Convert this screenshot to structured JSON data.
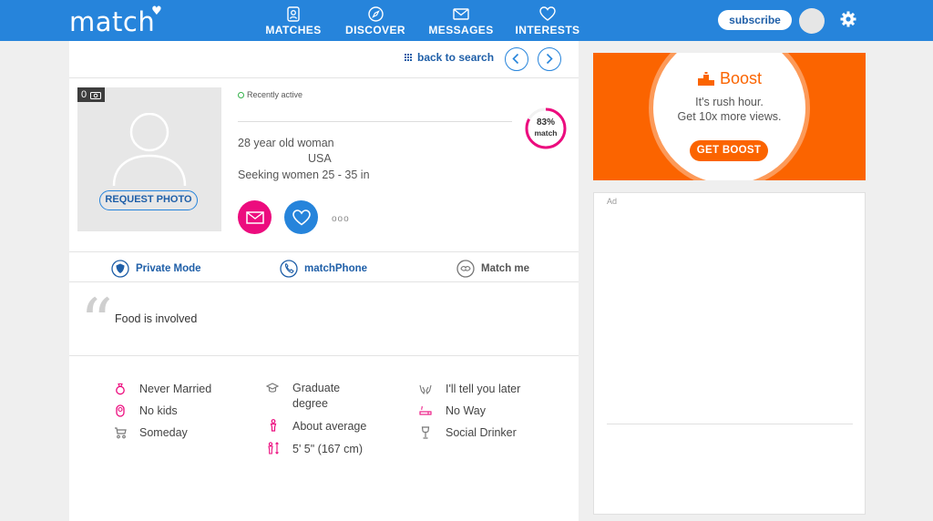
{
  "header": {
    "logo": "match",
    "nav": [
      {
        "label": "MATCHES",
        "icon": "matches-icon"
      },
      {
        "label": "DISCOVER",
        "icon": "compass-icon"
      },
      {
        "label": "MESSAGES",
        "icon": "envelope-icon"
      },
      {
        "label": "INTERESTS",
        "icon": "heart-icon"
      }
    ],
    "subscribe": "subscribe",
    "settings_icon": "gear-icon"
  },
  "profile_nav": {
    "back_to_search": "back to search"
  },
  "profile": {
    "photo_count": "0",
    "request_photo": "REQUEST PHOTO",
    "status": "Recently active",
    "age_gender": "28 year old woman",
    "location": "USA",
    "seeking": "Seeking women 25 - 35 in",
    "match_percent": "83%",
    "match_label": "match",
    "match_value": 0.83,
    "more": "ooo"
  },
  "features": [
    {
      "label": "Private Mode",
      "icon": "shield-icon"
    },
    {
      "label": "matchPhone",
      "icon": "phone-icon"
    },
    {
      "label": "Match me",
      "icon": "match-me-icon"
    }
  ],
  "quote": {
    "mark": "“",
    "text": "Food is involved"
  },
  "details": {
    "col1": [
      {
        "label": "Never Married",
        "icon": "ring-icon"
      },
      {
        "label": "No kids",
        "icon": "baby-icon"
      },
      {
        "label": "Someday",
        "icon": "stroller-icon"
      }
    ],
    "col2": [
      {
        "label": "Graduate degree",
        "icon": "graduation-cap-icon"
      },
      {
        "label": "About average",
        "icon": "body-type-icon"
      },
      {
        "label": "5' 5\" (167 cm)",
        "icon": "height-icon"
      }
    ],
    "col3": [
      {
        "label": "I'll tell you later",
        "icon": "hands-icon"
      },
      {
        "label": "No Way",
        "icon": "cigarette-icon"
      },
      {
        "label": "Social Drinker",
        "icon": "wine-glass-icon"
      }
    ]
  },
  "boost": {
    "title": "Boost",
    "line1": "It's rush hour.",
    "line2": "Get 10x more views.",
    "button": "GET BOOST"
  },
  "ad": {
    "label": "Ad"
  },
  "colors": {
    "brand_blue": "#2684db",
    "pink": "#ec0c7e",
    "orange": "#fb6400"
  }
}
